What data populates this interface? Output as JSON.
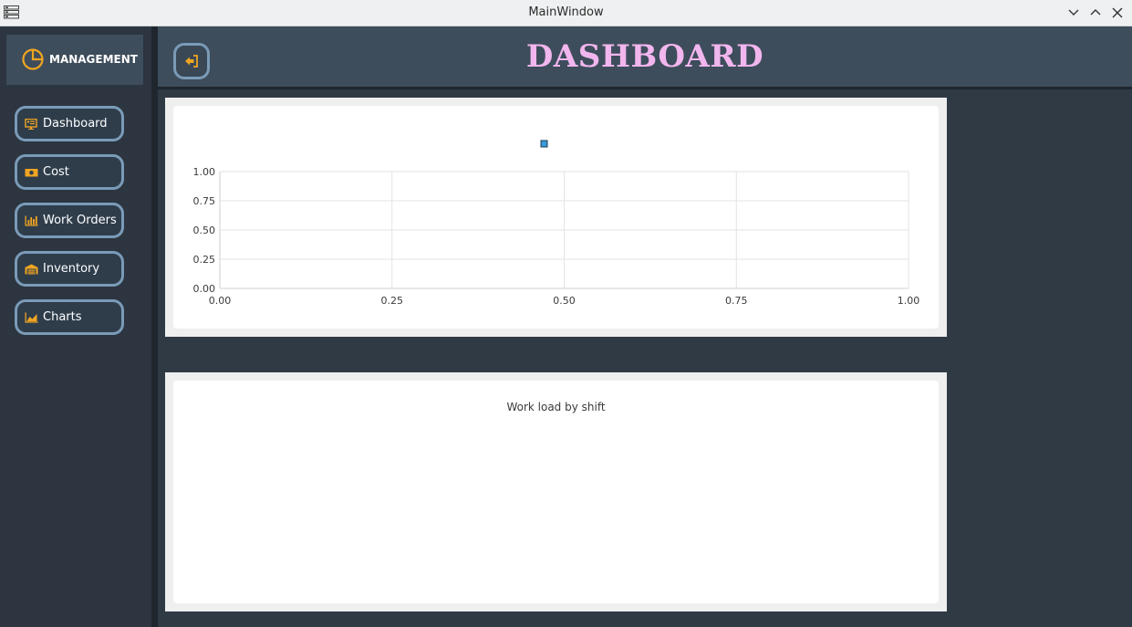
{
  "window": {
    "title": "MainWindow"
  },
  "sidebar": {
    "brand": "MANAGEMENT",
    "items": [
      {
        "label": "Dashboard",
        "icon": "monitor-chart-icon"
      },
      {
        "label": "Cost",
        "icon": "money-bill-icon"
      },
      {
        "label": "Work Orders",
        "icon": "bar-chart-icon"
      },
      {
        "label": "Inventory",
        "icon": "warehouse-icon"
      },
      {
        "label": "Charts",
        "icon": "area-chart-icon"
      }
    ]
  },
  "header": {
    "title": "DASHBOARD",
    "back_icon": "sign-out-icon"
  },
  "colors": {
    "accent": "#f0a521",
    "title": "#f2b6ee",
    "button_border": "#7a9bb8",
    "legend_marker": "#3a9bd9"
  },
  "chart_data": [
    {
      "type": "scatter",
      "title": "",
      "series": [
        {
          "values": []
        }
      ],
      "xlim": [
        0,
        1
      ],
      "ylim": [
        0,
        1
      ],
      "x_ticks": [
        "0.00",
        "0.25",
        "0.50",
        "0.75",
        "1.00"
      ],
      "y_ticks": [
        "0.00",
        "0.25",
        "0.50",
        "0.75",
        "1.00"
      ],
      "grid": true,
      "legend": "top-center"
    },
    {
      "type": "bar",
      "title": "Work load by shift",
      "categories": [],
      "values": []
    }
  ]
}
